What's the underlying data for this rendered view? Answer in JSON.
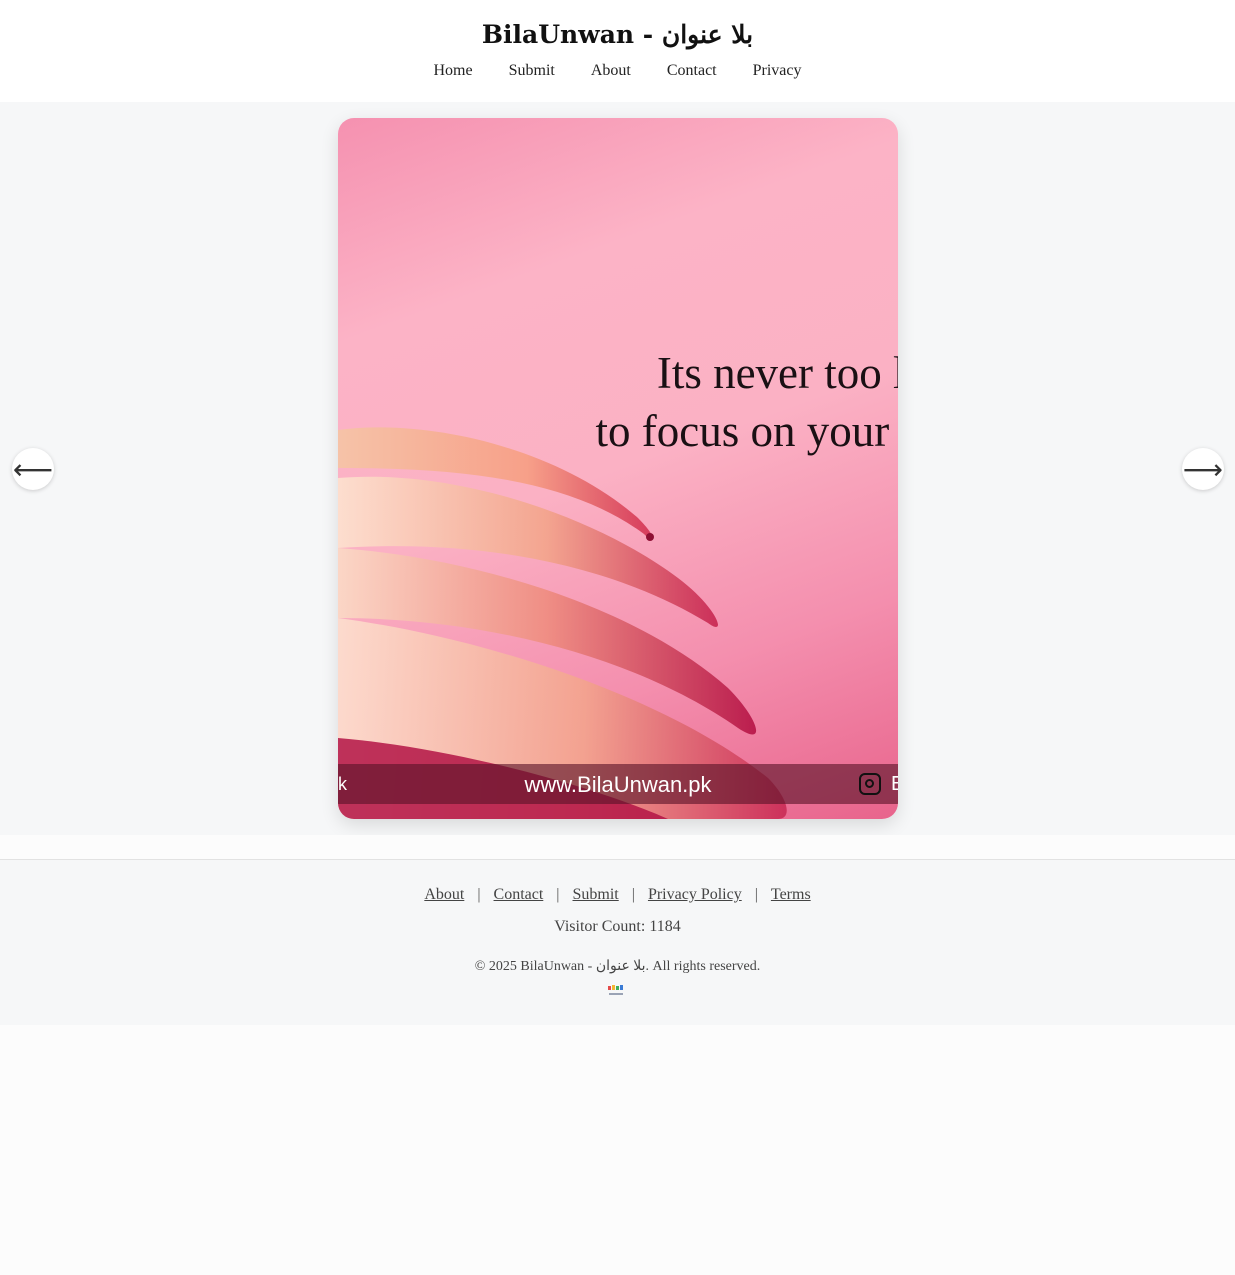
{
  "header": {
    "title": "BilaUnwan - بلا عنوان",
    "nav": [
      "Home",
      "Submit",
      "About",
      "Contact",
      "Privacy"
    ]
  },
  "slide": {
    "quote_line1": "Its never too lat",
    "quote_line2": "to focus on your dr",
    "band_left": "k",
    "band_url": "www.BilaUnwan.pk",
    "band_right": "E",
    "prev_label": "⟵",
    "next_label": "⟶"
  },
  "footer": {
    "links": [
      "About",
      "Contact",
      "Submit",
      "Privacy Policy",
      "Terms"
    ],
    "separator": "|",
    "visitor": "Visitor Count: 1184",
    "copyright": "© 2025 BilaUnwan - بلا عنوان. All rights reserved."
  },
  "icons": {
    "prev": "arrow-left-icon",
    "next": "arrow-right-icon",
    "instagram": "instagram-icon",
    "logo": "site-logo-icon"
  },
  "colors": {
    "page_bg": "#f6f7f8",
    "header_bg": "#ffffff",
    "band_bg": "#5a1428"
  }
}
